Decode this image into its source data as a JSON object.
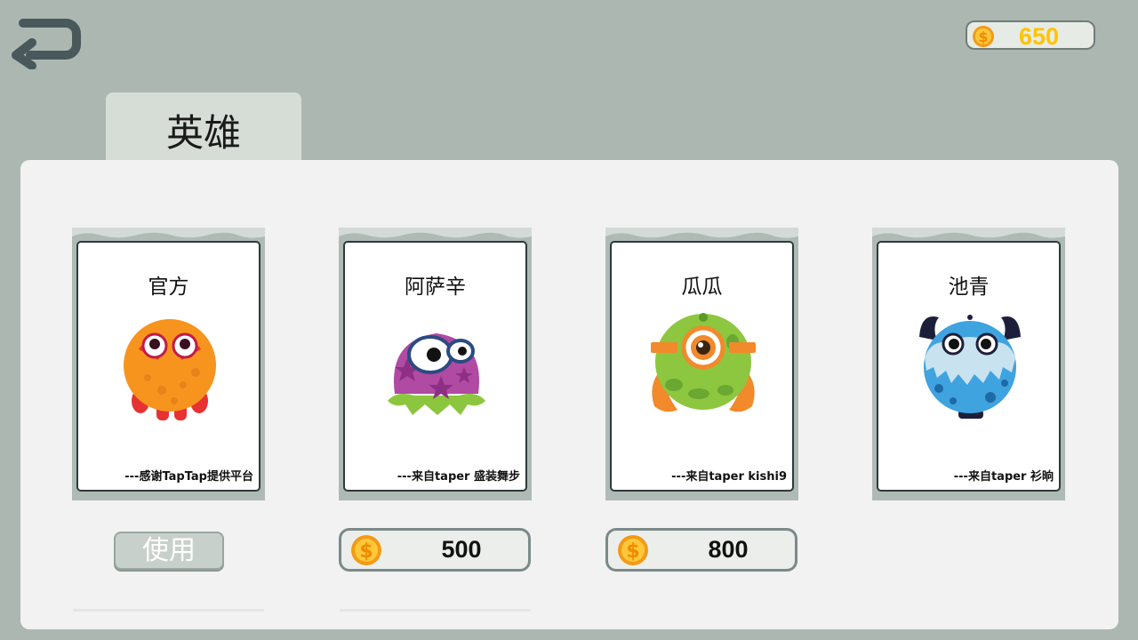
{
  "header": {
    "back_icon": "return-arrow-icon",
    "coin_icon": "dollar-coin-icon",
    "coin_balance": "650"
  },
  "tab": {
    "label": "英雄"
  },
  "colors": {
    "background": "#adb7b2",
    "panel": "#f2f2f2",
    "coin": "#ffc400",
    "tab": "#d6ddd6"
  },
  "heroes": [
    {
      "name": "官方",
      "credit": "---感谢TapTap提供平台",
      "monster": "orange-monster-icon",
      "action": "使用"
    },
    {
      "name": "阿萨辛",
      "credit": "---来自taper 盛装舞步",
      "monster": "purple-monster-icon",
      "price": "500"
    },
    {
      "name": "瓜瓜",
      "credit": "---来自taper kishi9",
      "monster": "green-cyclops-monster-icon",
      "price": "800"
    },
    {
      "name": "池青",
      "credit": "---来自taper 衫晌",
      "monster": "blue-furry-monster-icon"
    }
  ]
}
